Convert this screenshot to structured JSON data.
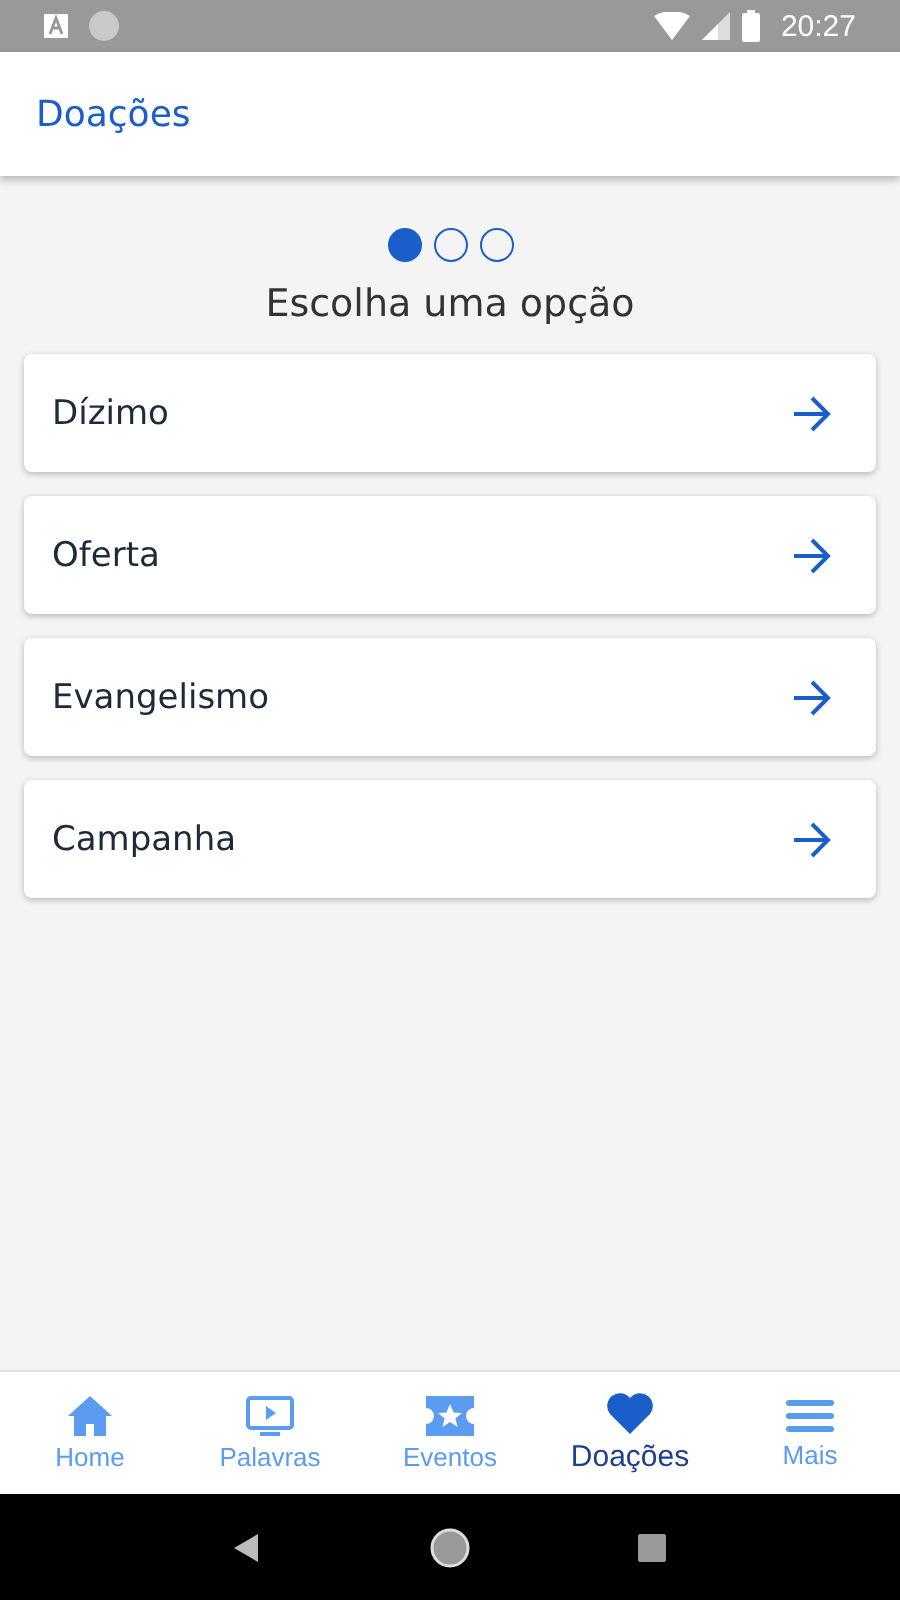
{
  "status_bar": {
    "time": "20:27"
  },
  "header": {
    "title": "Doações"
  },
  "steps": [
    {
      "selected": true
    },
    {
      "selected": false
    },
    {
      "selected": false
    }
  ],
  "prompt": "Escolha uma opção",
  "options": [
    {
      "label": "Dízimo"
    },
    {
      "label": "Oferta"
    },
    {
      "label": "Evangelismo"
    },
    {
      "label": "Campanha"
    }
  ],
  "tabs": [
    {
      "label": "Home",
      "kind": "home",
      "selected": false
    },
    {
      "label": "Palavras",
      "kind": "video",
      "selected": false
    },
    {
      "label": "Eventos",
      "kind": "ticket",
      "selected": false
    },
    {
      "label": "Doações",
      "kind": "heart",
      "selected": true
    },
    {
      "label": "Mais",
      "kind": "menu",
      "selected": false
    }
  ]
}
